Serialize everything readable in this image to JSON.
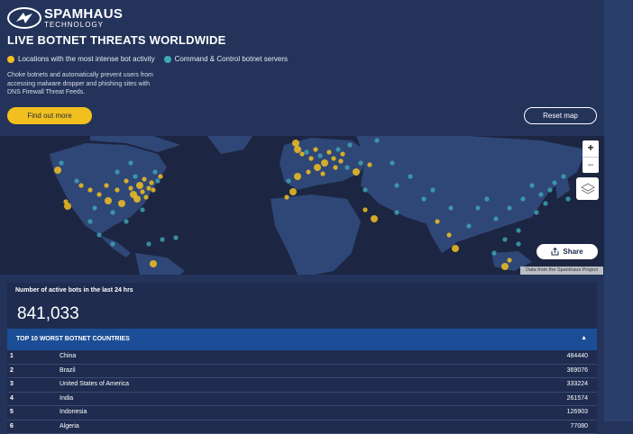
{
  "brand": {
    "name_line1": "SPAMHAUS",
    "name_line2": "TECHNOLOGY"
  },
  "header": {
    "title": "LIVE BOTNET THREATS WORLDWIDE",
    "legend_bots": "Locations with the most intense bot activity",
    "legend_cc": "Command & Control botnet servers",
    "description": "Choke botnets and automatically prevent users from accessing malware dropper and phishing sites with DNS Firewall Threat Feeds.",
    "find_out_more": "Find out more",
    "reset_map": "Reset map"
  },
  "colors": {
    "bot": "#f2c01e",
    "cc": "#3fa9b5",
    "accent": "#1b4e96"
  },
  "map": {
    "zoom_in": "+",
    "zoom_out": "−",
    "share": "Share",
    "attribution": "Data from the Spamhaus Project",
    "icons": [
      "plus-icon",
      "minus-icon",
      "layers-icon",
      "share-icon"
    ]
  },
  "stats": {
    "label": "Number of active bots in the last 24 hrs",
    "value": "841,033"
  },
  "top10": {
    "heading": "TOP 10 WORST BOTNET COUNTRIES",
    "toggle": "▲",
    "rows": [
      {
        "rank": "1",
        "country": "China",
        "count": "484440"
      },
      {
        "rank": "2",
        "country": "Brazil",
        "count": "369076"
      },
      {
        "rank": "3",
        "country": "United States of America",
        "count": "333224"
      },
      {
        "rank": "4",
        "country": "India",
        "count": "261574"
      },
      {
        "rank": "5",
        "country": "Indonesia",
        "count": "126903"
      },
      {
        "rank": "6",
        "country": "Algeria",
        "count": "77080"
      }
    ]
  }
}
